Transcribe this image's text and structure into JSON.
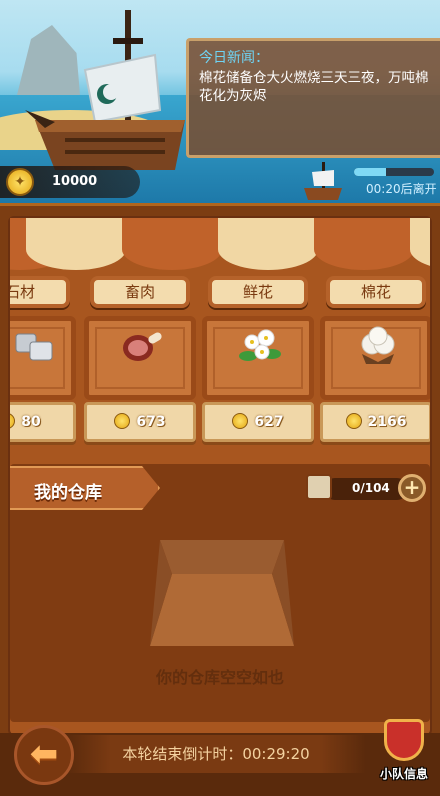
{
  "news": {
    "title": "今日新闻：",
    "body": "棉花储备仓大火燃烧三天三夜，万吨棉花化为灰烬"
  },
  "player": {
    "coins": "10000"
  },
  "departure": {
    "progress": 0.4,
    "time_text": "00:20后离开"
  },
  "market": {
    "goods": [
      {
        "name": "石材",
        "price": "80",
        "icon": "stone-icon"
      },
      {
        "name": "畜肉",
        "price": "673",
        "icon": "meat-icon"
      },
      {
        "name": "鲜花",
        "price": "627",
        "icon": "flower-icon"
      },
      {
        "name": "棉花",
        "price": "2166",
        "icon": "cotton-icon"
      }
    ]
  },
  "warehouse": {
    "title": "我的仓库",
    "capacity": "0/104",
    "empty_text": "你的仓库空空如也"
  },
  "footer": {
    "countdown": "本轮结束倒计时：00:29:20",
    "team_label": "小队信息"
  },
  "colors": {
    "news_title": "#6fd3f3",
    "board": "#a8561f",
    "awning_red": "#c0622a",
    "awning_cream": "#f1d7a4"
  }
}
